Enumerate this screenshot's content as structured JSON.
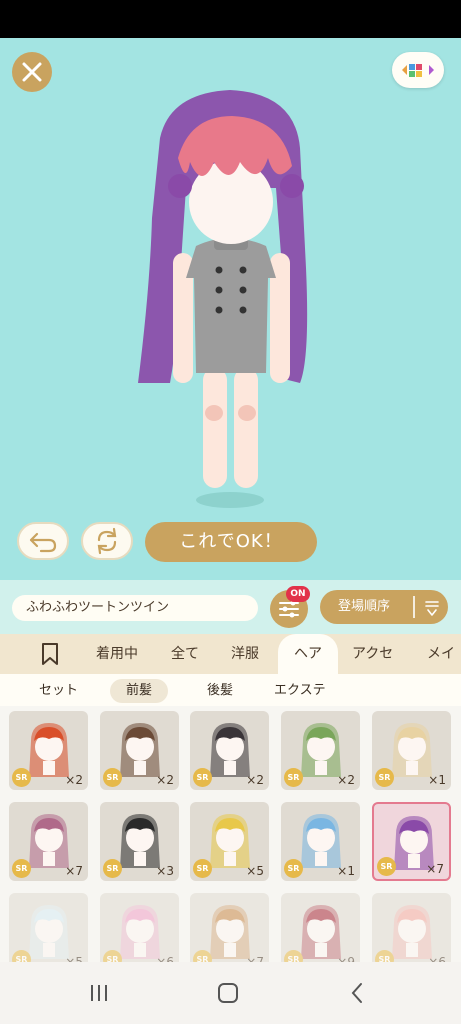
{
  "stage": {
    "ok_label": "これでOK！"
  },
  "toolbar": {
    "name": "ふわふわツートンツイン",
    "filter_badge": "ON",
    "sort_label": "登場順序"
  },
  "categories": [
    "着用中",
    "全て",
    "洋服",
    "ヘア",
    "アクセ",
    "メイク"
  ],
  "active_category": "ヘア",
  "subcategories": [
    "セット",
    "前髪",
    "後髪",
    "エクステ"
  ],
  "active_subcategory": "前髪",
  "items": [
    {
      "rarity": "SR",
      "count": "×2",
      "hair": "#d94f2a"
    },
    {
      "rarity": "SR",
      "count": "×2",
      "hair": "#6b4a36"
    },
    {
      "rarity": "SR",
      "count": "×2",
      "hair": "#3a3438"
    },
    {
      "rarity": "SR",
      "count": "×2",
      "hair": "#7aa65a"
    },
    {
      "rarity": "SR",
      "count": "×1",
      "hair": "#e8d2a2"
    },
    {
      "rarity": "SR",
      "count": "×7",
      "hair": "#b06a8a"
    },
    {
      "rarity": "SR",
      "count": "×3",
      "hair": "#2a2a2a"
    },
    {
      "rarity": "SR",
      "count": "×5",
      "hair": "#e8c84a"
    },
    {
      "rarity": "SR",
      "count": "×1",
      "hair": "#7ab6e2"
    },
    {
      "rarity": "SR",
      "count": "×7",
      "hair": "#8a4aa8"
    },
    {
      "rarity": "SR",
      "count": "×5",
      "hair": "#d8ecf4"
    },
    {
      "rarity": "SR",
      "count": "×6",
      "hair": "#f0a2c8"
    },
    {
      "rarity": "SR",
      "count": "×7",
      "hair": "#c88a4a"
    },
    {
      "rarity": "SR",
      "count": "×9",
      "hair": "#a82a3a"
    },
    {
      "rarity": "SR",
      "count": "×6",
      "hair": "#f4a8a0"
    }
  ],
  "selected_item_index": 9,
  "colors": {
    "background": "#a3e4e2",
    "accent": "#c9a35f",
    "badge": "#e2324a"
  }
}
